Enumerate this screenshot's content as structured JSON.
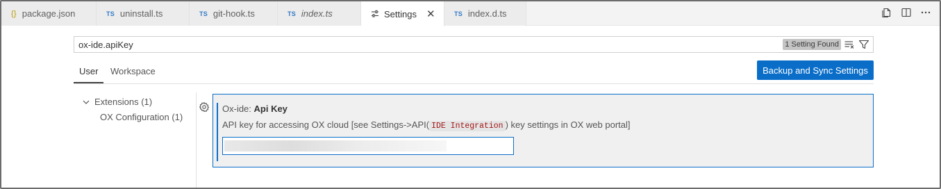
{
  "tabs": [
    {
      "icon": "{}",
      "icon_name": "json-braces-icon",
      "label": "package.json",
      "italic": false
    },
    {
      "icon": "TS",
      "icon_name": "typescript-icon",
      "label": "uninstall.ts",
      "italic": false
    },
    {
      "icon": "TS",
      "icon_name": "typescript-icon",
      "label": "git-hook.ts",
      "italic": false
    },
    {
      "icon": "TS",
      "icon_name": "typescript-icon",
      "label": "index.ts",
      "italic": true
    },
    {
      "icon": "⚙",
      "icon_name": "settings-icon",
      "label": "Settings",
      "italic": false,
      "active": true,
      "close": "✕"
    },
    {
      "icon": "TS",
      "icon_name": "typescript-icon",
      "label": "index.d.ts",
      "italic": false
    }
  ],
  "editor_actions": [
    "open-changes-icon",
    "split-editor-icon",
    "more-actions-icon"
  ],
  "search": {
    "value": "ox-ide.apiKey",
    "result_badge": "1 Setting Found"
  },
  "scope_tabs": {
    "user": "User",
    "workspace": "Workspace"
  },
  "sync_button": "Backup and Sync Settings",
  "toc": {
    "extensions": "Extensions (1)",
    "ox_configuration": "OX Configuration (1)"
  },
  "setting": {
    "category": "Ox-ide: ",
    "name": "Api Key",
    "description_before": "API key for accessing OX cloud [see Settings->API(",
    "description_code": "IDE Integration",
    "description_after": ") key settings in OX web portal]"
  },
  "colors": {
    "accent": "#0a6ec9",
    "typescript": "#3178c6",
    "json": "#b59a00",
    "code_text": "#a31515"
  }
}
